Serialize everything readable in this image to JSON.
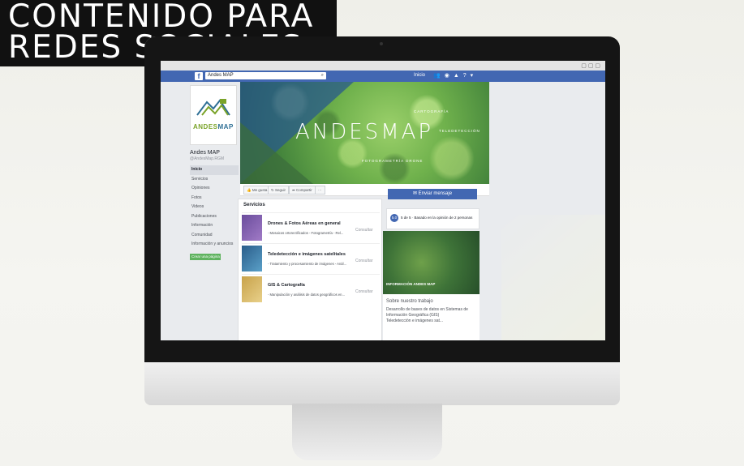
{
  "headline": {
    "line1": "CONTENIDO PARA",
    "line2": "REDES SOCIALES"
  },
  "fb": {
    "search_value": "Andes MAP",
    "nav_home": "Inicio"
  },
  "page": {
    "logo_andes": "ANDES",
    "logo_map": "MAP",
    "name": "Andes MAP",
    "handle": "@AndesMap.RGM",
    "nav": [
      "Inicio",
      "Servicios",
      "Opiniones",
      "Fotos",
      "Videos",
      "Publicaciones",
      "Información",
      "Comunidad",
      "Información y anuncios"
    ],
    "promo_button": "Crear una página"
  },
  "cover": {
    "title": "ANDESMAP",
    "tag1": "CARTOGRAFÍA",
    "tag2": "TELEDETECCIÓN",
    "tag3": "FOTOGRAMETRÍA DRONE"
  },
  "actions": {
    "like": "Me gusta",
    "follow": "Seguir",
    "share": "Compartir",
    "more": "···",
    "send_message": "Enviar mensaje"
  },
  "services": {
    "title": "Servicios",
    "items": [
      {
        "name": "Drones & Fotos Aéreas en general",
        "desc": "- Mosaicos ortorectificados - Fotogrametría - Rel...",
        "link": "Consultar"
      },
      {
        "name": "Teledetección e imágenes satelitales",
        "desc": "- Tratamiento y procesamiento de imágenes - Anál...",
        "link": "Consultar"
      },
      {
        "name": "GIS & Cartografía",
        "desc": "- Manipulación y análisis de datos geográficos en...",
        "link": "Consultar"
      }
    ]
  },
  "rating": {
    "badge": "5.0",
    "text": "5 de 5 · Basado en la opinión de 2 personas"
  },
  "info_photo_label": "INFORMACIÓN ANDES MAP",
  "about": {
    "title": "Sobre nuestro trabajo",
    "text1": "Desarrollo de bases de datos en Sistemas de Información Geográfica (GIS)",
    "text2": "Teledetección e imágenes sat..."
  },
  "colors": {
    "fb_blue": "#4267b2",
    "promo_green": "#5fb35f"
  }
}
